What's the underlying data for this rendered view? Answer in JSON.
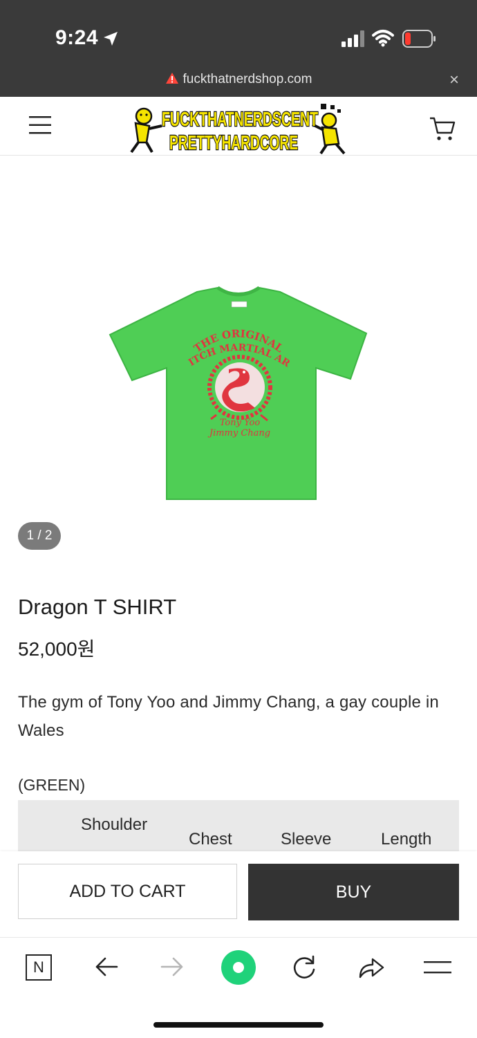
{
  "status_bar": {
    "time": "9:24",
    "url": "fuckthatnerdshop.com",
    "close_symbol": "×"
  },
  "header": {
    "logo_line1": "FUCKTHATNERDSCENT",
    "logo_line2": "PRETTYHARDCORE",
    "menu_icon": "hamburger-menu-icon",
    "cart_icon": "shopping-cart-icon"
  },
  "product": {
    "image_counter": "1 / 2",
    "shirt_print": {
      "arc_top1": "THE ORIGINAL",
      "arc_top2": "SNITCH MARTIAL ARTS",
      "script1": "Tony Yoo",
      "script2": "Jimmy Chang"
    },
    "title": "Dragon T SHIRT",
    "price": "52,000원",
    "description": "The gym of Tony Yoo and Jimmy Chang, a gay couple in Wales",
    "color": "(GREEN)",
    "size_headers": [
      "Shoulder",
      "Chest",
      "Sleeve",
      "Length"
    ]
  },
  "actions": {
    "add_to_cart": "ADD TO CART",
    "buy": "BUY"
  },
  "browser_toolbar": {
    "n_label": "N",
    "icons": [
      "naver-icon",
      "back-arrow-icon",
      "forward-arrow-icon",
      "green-dot-icon",
      "reload-icon",
      "share-icon",
      "menu-icon"
    ]
  },
  "colors": {
    "status_bg": "#3a3a3a",
    "shirt_green": "#4fce55",
    "print_red": "#e0353f",
    "logo_yellow": "#f5e400",
    "buy_bg": "#333333",
    "green_dot": "#1fd27a"
  }
}
